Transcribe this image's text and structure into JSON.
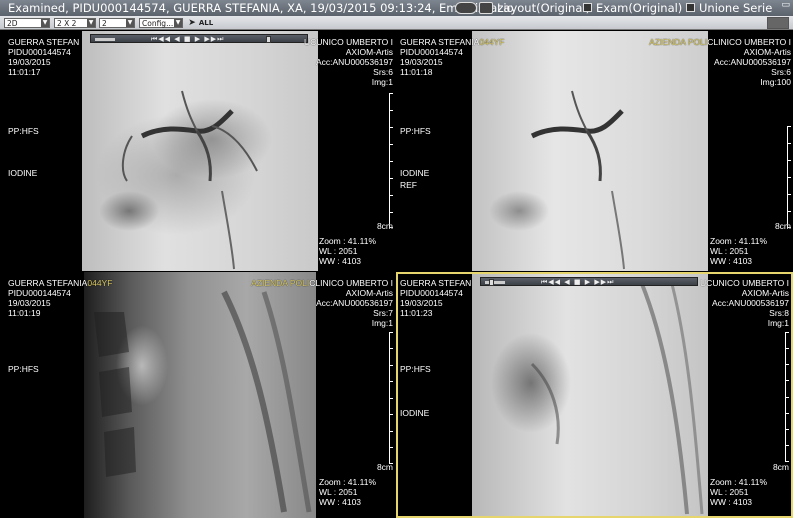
{
  "titlebar": {
    "title": "Examined, PIDU000144574, GUERRA STEFANIA, XA, 19/03/2015 09:13:24, Embolizzazio",
    "layout_label": "Layout(Original)",
    "exam_label": "Exam(Original)",
    "merge_label": "Unione Serie"
  },
  "toolbar": {
    "mode_select": "2D",
    "layout_select": "2 X 2",
    "count_select": "2",
    "config_select": "Config...",
    "all_label": "ALL"
  },
  "viewports": [
    {
      "id": "tl",
      "patient": "GUERRA STEFAN",
      "pid": "PIDU000144574",
      "date": "19/03/2015",
      "time": "11:01:17",
      "hospital": "UCUNICO UMBERTO I",
      "device": "AXIOM-Artis",
      "acc": "Acc:ANU000536197",
      "series": "Srs:6",
      "image": "Img:1",
      "position": "PP:HFS",
      "contrast": "IODINE",
      "ref": "",
      "scale": "8cm",
      "zoom": "Zoom : 41.11%",
      "wl": "WL : 2051",
      "ww": "WW : 4103"
    },
    {
      "id": "tr",
      "patient": "GUERRA STEFANIA",
      "pid_tag": "044YF",
      "pid": "PIDU000144574",
      "date": "19/03/2015",
      "time": "11:01:18",
      "hospital_pre": "AZIENDA POLI",
      "hospital": "CLINICO UMBERTO I",
      "device": "AXIOM-Artis",
      "acc": "Acc:ANU000536197",
      "series": "Srs:6",
      "image": "Img:100",
      "position": "PP:HFS",
      "contrast": "IODINE",
      "ref": "REF",
      "scale": "8cm",
      "zoom": "Zoom : 41.11%",
      "wl": "WL : 2051",
      "ww": "WW : 4103"
    },
    {
      "id": "bl",
      "patient": "GUERRA STEFANIA",
      "pid_tag": "044YF",
      "pid": "PIDU000144574",
      "date": "19/03/2015",
      "time": "11:01:19",
      "hospital_pre": "AZIENDA POLI",
      "hospital": "CLINICO UMBERTO I",
      "device": "AXIOM-Artis",
      "acc": "Acc:ANU000536197",
      "series": "Srs:7",
      "image": "Img:1",
      "position": "PP:HFS",
      "contrast": "",
      "ref": "",
      "scale": "8cm",
      "zoom": "Zoom : 41.11%",
      "wl": "WL : 2051",
      "ww": "WW : 4103"
    },
    {
      "id": "br",
      "patient": "GUERRA STEFAN",
      "pid": "PIDU000144574",
      "date": "19/03/2015",
      "time": "11:01:23",
      "hospital": "UCUNICO UMBERTO I",
      "device": "AXIOM-Artis",
      "acc": "Acc:ANU000536197",
      "series": "Srs:8",
      "image": "Img:1",
      "position": "PP:HFS",
      "contrast": "IODINE",
      "ref": "",
      "scale": "8cm",
      "zoom": "Zoom : 41.11%",
      "wl": "WL : 2051",
      "ww": "WW : 4103"
    }
  ],
  "cine_controls": "⏮◀◀ ◀ ■ ▶ ▶▶⏭",
  "colors": {
    "active_border": "#e6d46c",
    "hospital_highlight": "#c9a6f5"
  }
}
